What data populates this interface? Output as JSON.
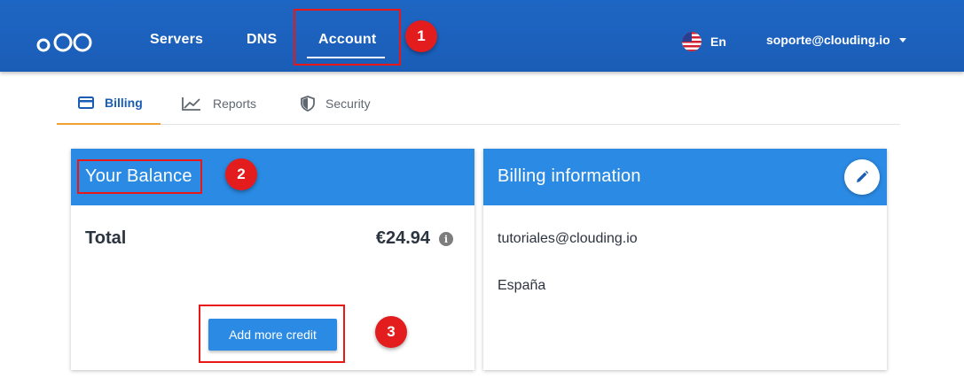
{
  "nav": {
    "items": [
      {
        "label": "Servers"
      },
      {
        "label": "DNS"
      },
      {
        "label": "Account",
        "active": true
      }
    ],
    "language": "En",
    "user_email": "soporte@clouding.io"
  },
  "tabs": [
    {
      "label": "Billing",
      "icon": "credit-card-icon",
      "active": true
    },
    {
      "label": "Reports",
      "icon": "trend-chart-icon"
    },
    {
      "label": "Security",
      "icon": "shield-icon"
    }
  ],
  "balance_card": {
    "title": "Your Balance",
    "total_label": "Total",
    "total_value": "€24.94",
    "info_icon": "i",
    "add_credit_label": "Add more credit"
  },
  "billing_card": {
    "title": "Billing information",
    "email": "tutoriales@clouding.io",
    "country": "España"
  },
  "annotations": {
    "badge_1": "1",
    "badge_2": "2",
    "badge_3": "3"
  },
  "colors": {
    "topbar": "#1a5db7",
    "card_header": "#2b8ae3",
    "highlight": "#e81818",
    "tab_underline": "#f0a030"
  }
}
